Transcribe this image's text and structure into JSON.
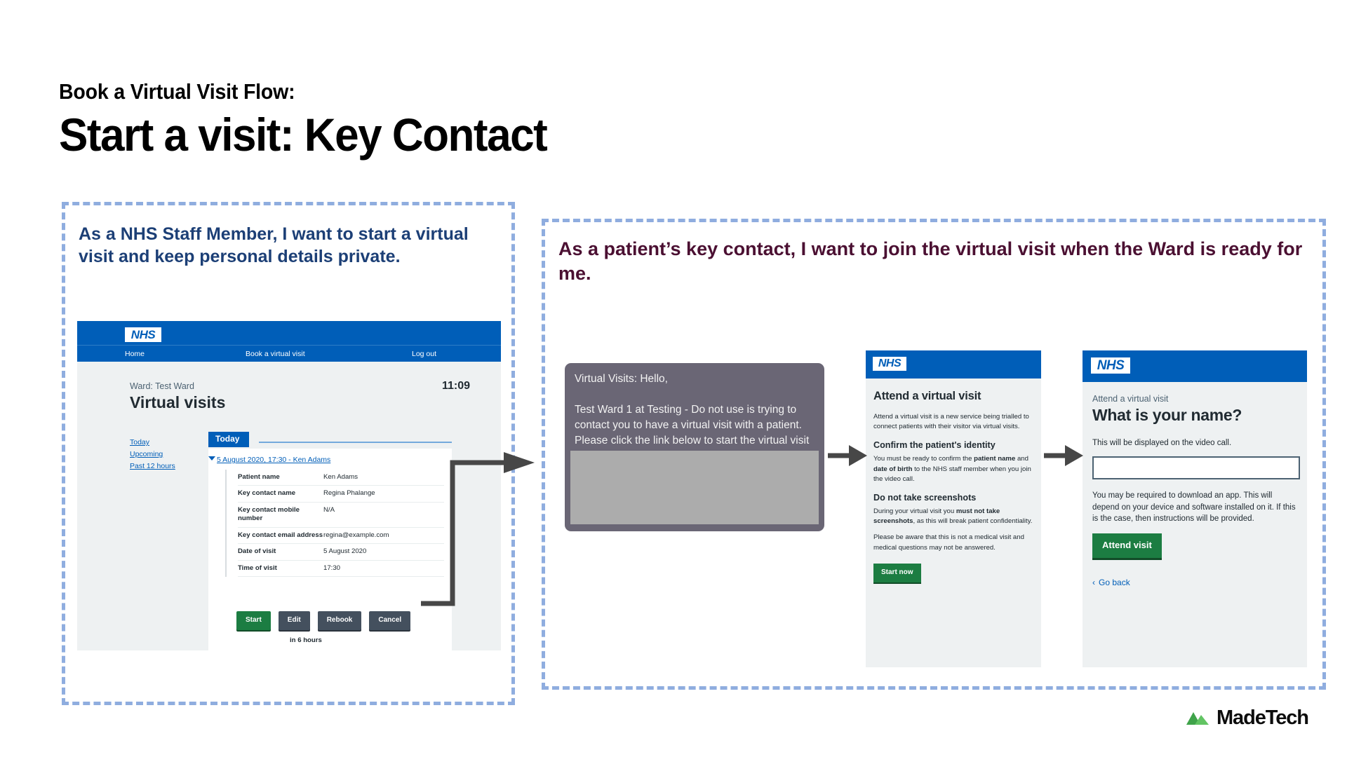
{
  "header": {
    "eyebrow": "Book a Virtual Visit Flow:",
    "title": "Start a visit: Key Contact"
  },
  "panels": {
    "left_story": "As a NHS Staff Member, I want to start a virtual visit and keep personal details private.",
    "right_story": "As a patient’s key contact, I want to join the virtual visit when the Ward is ready for me."
  },
  "screen1": {
    "logo": "NHS",
    "nav": [
      "Home",
      "Book a virtual visit",
      "Log out"
    ],
    "ward_label": "Ward: Test Ward",
    "page_title": "Virtual visits",
    "clock": "11:09",
    "side_links": [
      "Today",
      "Upcoming",
      "Past 12 hours"
    ],
    "tab_label": "Today",
    "visit_link": "5 August 2020, 17:30 - Ken Adams",
    "table": [
      {
        "key": "Patient name",
        "value": "Ken Adams"
      },
      {
        "key": "Key contact name",
        "value": "Regina Phalange"
      },
      {
        "key": "Key contact mobile number",
        "value": "N/A"
      },
      {
        "key": "Key contact email address",
        "value": "regina@example.com"
      },
      {
        "key": "Date of visit",
        "value": "5 August 2020"
      },
      {
        "key": "Time of visit",
        "value": "17:30"
      }
    ],
    "buttons": [
      "Start",
      "Edit",
      "Rebook",
      "Cancel"
    ],
    "footnote": "in 6 hours"
  },
  "sms": {
    "line1": "Virtual Visits: Hello,",
    "line2": "Test Ward 1 at Testing - Do not use is trying to contact you to have a virtual visit with a patient. Please click the link below to start the virtual visit"
  },
  "screen3": {
    "logo": "NHS",
    "heading": "Attend a virtual visit",
    "intro": "Attend a virtual visit is a new service being trialled to connect patients with their visitor via virtual visits.",
    "section1_heading": "Confirm the patient's identity",
    "section1_body_a": "You must be ready to confirm the ",
    "section1_bold_a": "patient name",
    "section1_body_b": " and ",
    "section1_bold_b": "date of birth",
    "section1_body_c": " to the NHS staff member when you join the video call.",
    "section2_heading": "Do not take screenshots",
    "section2_body_a": "During your virtual visit you ",
    "section2_bold_a": "must not take screenshots",
    "section2_body_b": ", as this will break patient confidentiality.",
    "section2_body_c": "Please be aware that this is not a medical visit and medical questions may not be answered.",
    "button": "Start now"
  },
  "screen4": {
    "logo": "NHS",
    "caption": "Attend a virtual visit",
    "heading": "What is your name?",
    "hint": "This will be displayed on the video call.",
    "input_value": "",
    "input_placeholder": "",
    "body": "You may be required to download an app. This will depend on your device and software installed on it. If this is the case, then instructions will be provided.",
    "button": "Attend visit",
    "back_link": "Go back",
    "back_chevron": "‹"
  },
  "brand": {
    "name": "MadeTech"
  },
  "colors": {
    "nhs_blue": "#005eb8",
    "dashed_border": "#8faddf",
    "left_story_text": "#1c3f76",
    "right_story_text": "#4b1032",
    "green_button": "#1c7d42",
    "grey_button": "#44505e",
    "sms_bubble": "#6a6675",
    "arrow": "#474747",
    "madetech_green": "#4caf50"
  }
}
